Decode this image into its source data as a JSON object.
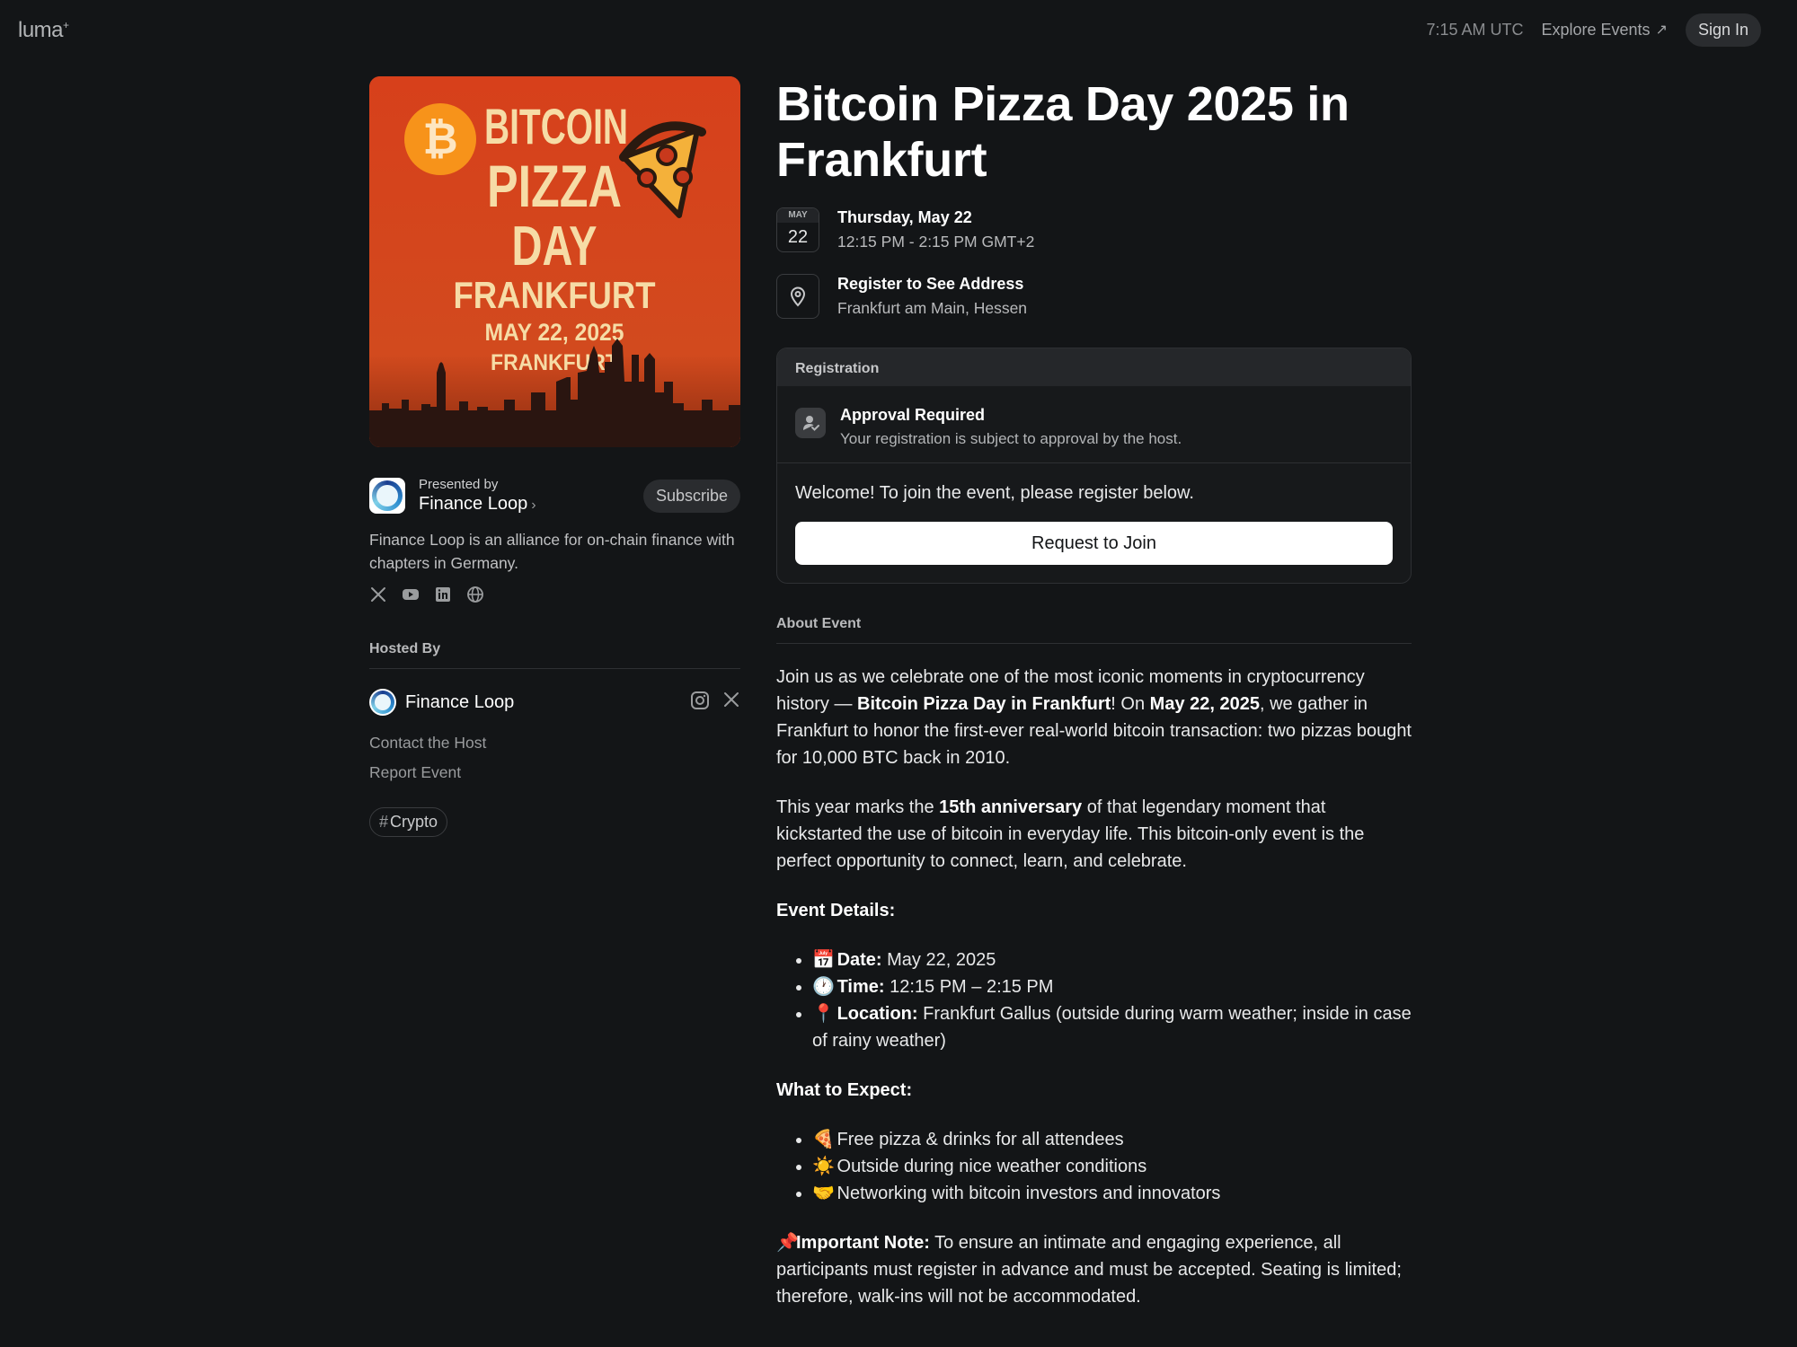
{
  "topbar": {
    "logo": "luma",
    "logo_mark": "+",
    "time": "7:15 AM UTC",
    "explore": "Explore Events",
    "explore_arrow": "↗",
    "signin": "Sign In"
  },
  "cover": {
    "line1": "BITCOIN",
    "line2": "PIZZA",
    "line3": "DAY",
    "line4": "FRANKFURT",
    "line5": "MAY 22, 2025",
    "line6": "FRANKFURT",
    "bg_color": "#d8441d",
    "text_color": "#f6dca6"
  },
  "presenter": {
    "label": "Presented by",
    "name": "Finance Loop",
    "chevron": "›",
    "subscribe": "Subscribe",
    "description": "Finance Loop is an alliance for on-chain finance with chapters in Germany.",
    "socials": [
      "x-icon",
      "youtube-icon",
      "linkedin-icon",
      "globe-icon"
    ]
  },
  "hosts": {
    "title": "Hosted By",
    "name": "Finance Loop",
    "contact": "Contact the Host",
    "report": "Report Event",
    "tag_hash": "#",
    "tag": "Crypto"
  },
  "event": {
    "title": "Bitcoin Pizza Day 2025 in Frankfurt",
    "cal_month": "MAY",
    "cal_day": "22",
    "date": "Thursday, May 22",
    "time": "12:15 PM - 2:15 PM GMT+2",
    "location_main": "Register to See Address",
    "location_sub": "Frankfurt am Main, Hessen"
  },
  "registration": {
    "header": "Registration",
    "approval_title": "Approval Required",
    "approval_sub": "Your registration is subject to approval by the host.",
    "welcome": "Welcome! To join the event, please register below.",
    "button": "Request to Join"
  },
  "about": {
    "title": "About Event",
    "p1_a": "Join us as we celebrate one of the most iconic moments in cryptocurrency history — ",
    "p1_b": "Bitcoin Pizza Day in Frankfurt",
    "p1_c": "! On ",
    "p1_d": "May 22, 2025",
    "p1_e": ", we gather in Frankfurt to honor the first-ever real-world bitcoin transaction: two pizzas bought for 10,000 BTC back in 2010.",
    "p2_a": "This year marks the ",
    "p2_b": "15th anniversary",
    "p2_c": " of that legendary moment that kickstarted the use of bitcoin in everyday life. This bitcoin-only event is the perfect opportunity to connect, learn, and celebrate.",
    "details_title": "Event Details:",
    "details": [
      {
        "emoji": "📅",
        "label": "Date:",
        "value": " May 22, 2025"
      },
      {
        "emoji": "🕐",
        "label": "Time:",
        "value": " 12:15 PM – 2:15 PM"
      },
      {
        "emoji": "📍",
        "label": "Location:",
        "value": " Frankfurt Gallus (outside during warm weather; inside in case of rainy weather)"
      }
    ],
    "expect_title": "What to Expect:",
    "expect": [
      {
        "emoji": "🍕",
        "text": " Free pizza & drinks for all attendees"
      },
      {
        "emoji": "☀️",
        "text": " Outside during nice weather conditions"
      },
      {
        "emoji": "🤝",
        "text": " Networking with bitcoin investors and innovators"
      }
    ],
    "note_emoji": "📌",
    "note_label": "Important Note:",
    "note_text": " To ensure an intimate and engaging experience, all participants must register in advance and must be accepted. Seating is limited; therefore, walk-ins will not be accommodated."
  }
}
